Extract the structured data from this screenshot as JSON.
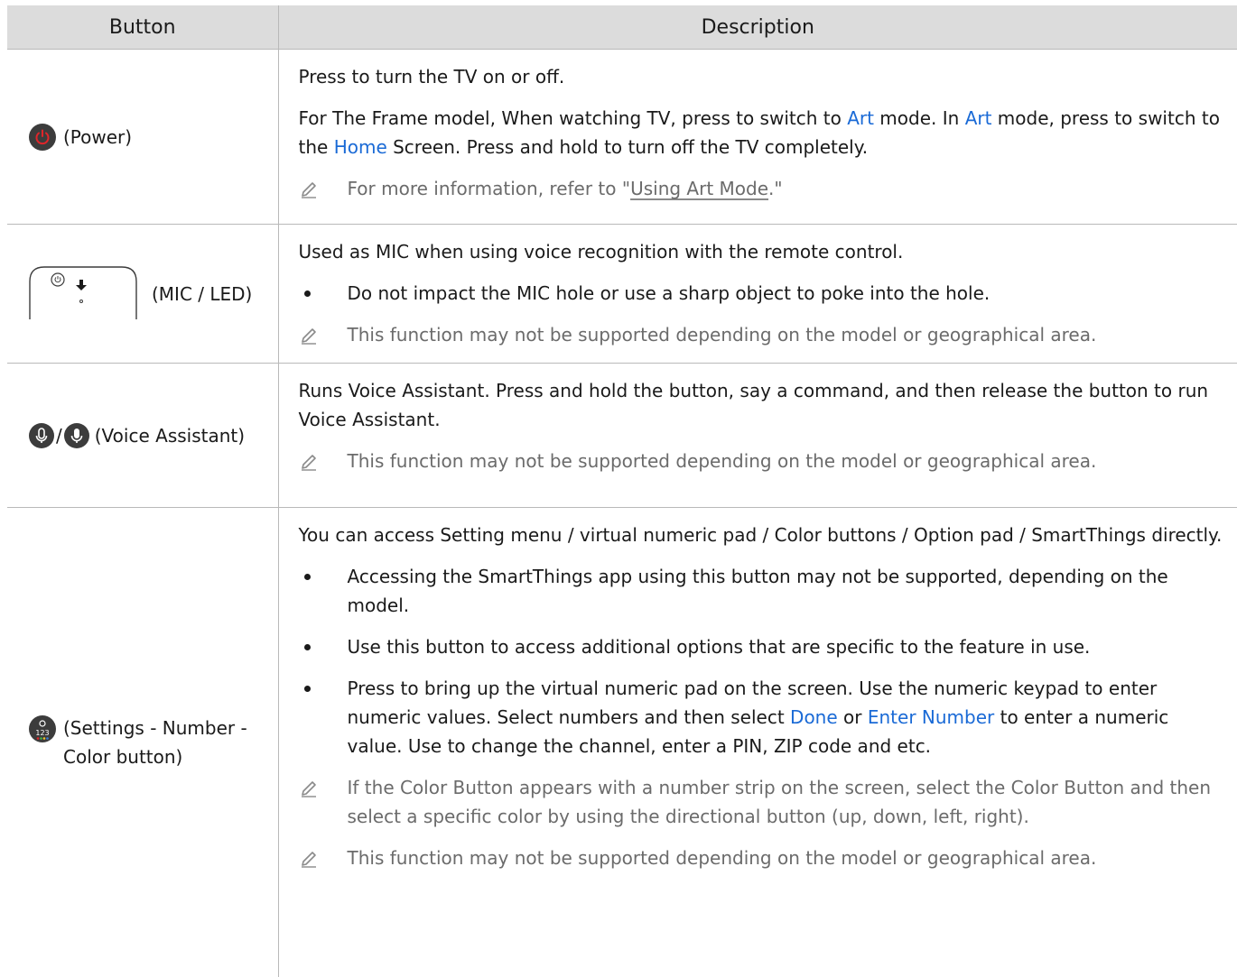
{
  "table": {
    "headers": {
      "button": "Button",
      "description": "Description"
    },
    "rows": [
      {
        "button_label": "(Power)",
        "icon": "power-icon",
        "paragraphs": [
          "Press to turn the TV on or off."
        ],
        "frame_text": {
          "t1": "For The Frame model, When watching TV, press to switch to ",
          "art1": "Art",
          "t2": " mode. In ",
          "art2": "Art",
          "t3": " mode, press to switch to the ",
          "home": "Home",
          "t4": " Screen. Press and hold to turn off the TV completely."
        },
        "note": {
          "before": "For more information, refer to \"",
          "link": "Using Art Mode",
          "after": ".\""
        }
      },
      {
        "button_label": "(MIC / LED)",
        "icon": "mic-led-icon",
        "paragraphs": [
          "Used as MIC when using voice recognition with the remote control."
        ],
        "bullets": [
          "Do not impact the MIC hole or use a sharp object to poke into the hole."
        ],
        "notes": [
          "This function may not be supported depending on the model or geographical area."
        ]
      },
      {
        "button_label_slash": "/",
        "button_label": "(Voice Assistant)",
        "icon": "microphone-icon",
        "paragraphs": [
          "Runs Voice Assistant. Press and hold the button, say a command, and then release the button to run Voice Assistant."
        ],
        "notes": [
          "This function may not be supported depending on the model or geographical area."
        ]
      },
      {
        "button_label": "(Settings - Number - Color button)",
        "icon": "settings-number-color-icon",
        "paragraphs": [
          "You can access Setting menu / virtual numeric pad / Color buttons / Option pad / SmartThings directly."
        ],
        "bullets": [
          "Accessing the SmartThings app using this button may not be supported, depending on the model.",
          "Use this button to access additional options that are specific to the feature in use."
        ],
        "numpad_text": {
          "t1": "Press to bring up the virtual numeric pad on the screen. Use the numeric keypad to enter numeric values. Select numbers and then select ",
          "done": "Done",
          "t2": " or ",
          "enter": "Enter Number",
          "t3": " to enter a numeric value. Use to change the channel, enter a PIN, ZIP code and etc."
        },
        "notes": [
          "If the Color Button appears with a number strip on the screen, select the Color Button and then select a specific color by using the directional button (up, down, left, right).",
          "This function may not be supported depending on the model or geographical area."
        ]
      }
    ]
  },
  "colors": {
    "header_bg": "#dcdcdc",
    "highlight": "#1a6ad6",
    "note_text": "#6b6b6b",
    "power_red": "#e0252a"
  }
}
